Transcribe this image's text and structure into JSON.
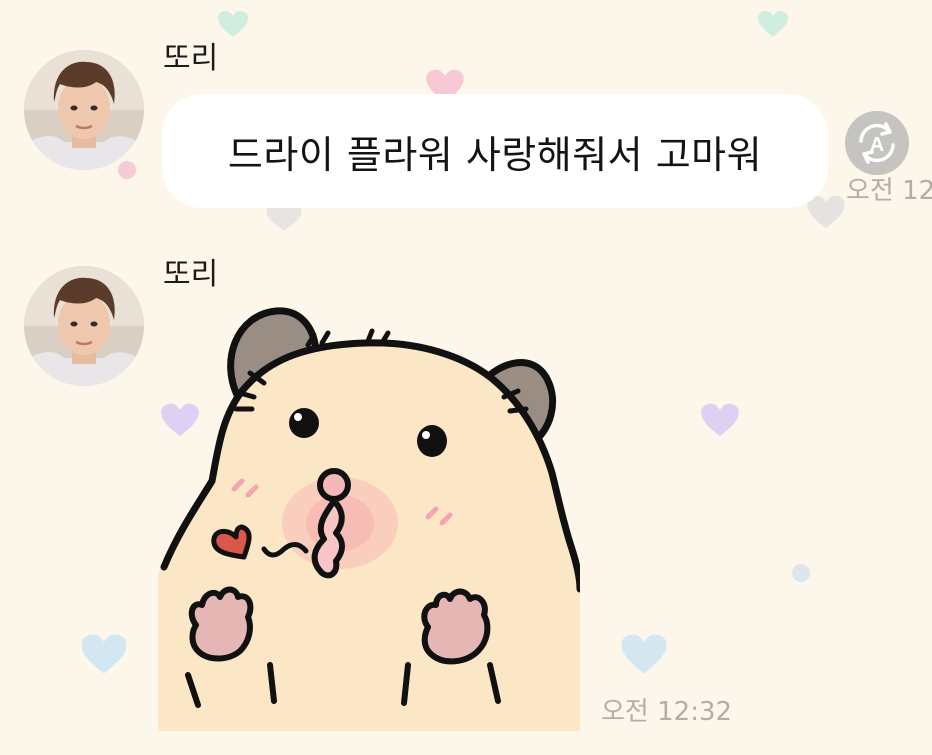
{
  "messages": [
    {
      "sender": "또리",
      "text": "드라이 플라워 사랑해줘서 고마워",
      "time": "오전 12"
    },
    {
      "sender": "또리",
      "sticker": "hamster-kiss-sticker",
      "time": "오전 12:32"
    }
  ],
  "icons": {
    "translate": "translate-icon"
  },
  "colors": {
    "background": "#fdf6ea",
    "bubble": "#ffffff",
    "timestamp": "#b2aea7",
    "translate_button": "#c6c4c0"
  }
}
